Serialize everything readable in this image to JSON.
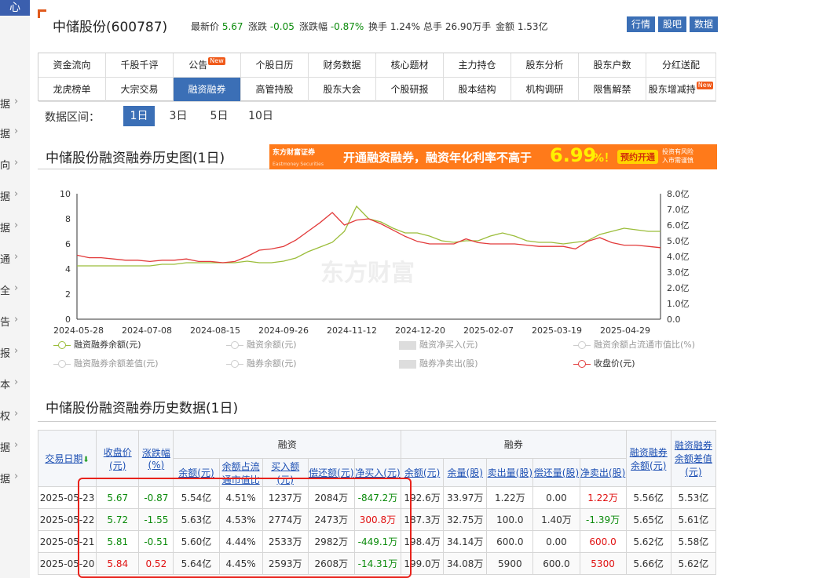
{
  "sidebar": {
    "logo": "心",
    "items": [
      {
        "label": "据",
        "y": 130
      },
      {
        "label": "据",
        "y": 168
      },
      {
        "label": "向",
        "y": 208
      },
      {
        "label": "据",
        "y": 248
      },
      {
        "label": "据",
        "y": 288
      },
      {
        "label": "通",
        "y": 328
      },
      {
        "label": "全",
        "y": 368
      },
      {
        "label": "告",
        "y": 408
      },
      {
        "label": "报",
        "y": 448
      },
      {
        "label": "本",
        "y": 488
      },
      {
        "label": "权",
        "y": 528
      },
      {
        "label": "据",
        "y": 568
      },
      {
        "label": "据",
        "y": 608
      }
    ],
    "chevron": "›"
  },
  "header": {
    "title": "中储股份(600787)",
    "quote": [
      {
        "label": "最新价",
        "value": "5.67",
        "color": "green"
      },
      {
        "label": "涨跌",
        "value": "-0.05",
        "color": "green"
      },
      {
        "label": "涨跌幅",
        "value": "-0.87%",
        "color": "green"
      },
      {
        "label": "换手",
        "value": "1.24%",
        "color": ""
      },
      {
        "label": "总手",
        "value": "26.90万手",
        "color": ""
      },
      {
        "label": "金额",
        "value": "1.53亿",
        "color": ""
      }
    ],
    "buttons": [
      "行情",
      "股吧",
      "数据"
    ]
  },
  "nav": {
    "row1": [
      {
        "label": "资金流向"
      },
      {
        "label": "千股千评"
      },
      {
        "label": "公告",
        "badge": "New"
      },
      {
        "label": "个股日历"
      },
      {
        "label": "财务数据"
      },
      {
        "label": "核心题材"
      },
      {
        "label": "主力持仓"
      },
      {
        "label": "股东分析"
      },
      {
        "label": "股东户数"
      },
      {
        "label": "分红送配"
      }
    ],
    "row2": [
      {
        "label": "龙虎榜单"
      },
      {
        "label": "大宗交易"
      },
      {
        "label": "融资融券",
        "active": true
      },
      {
        "label": "高管持股"
      },
      {
        "label": "股东大会"
      },
      {
        "label": "个股研报"
      },
      {
        "label": "股本结构"
      },
      {
        "label": "机构调研"
      },
      {
        "label": "限售解禁"
      },
      {
        "label": "股东增减持",
        "badge": "New"
      }
    ]
  },
  "range": {
    "label": "数据区间：",
    "options": [
      "1日",
      "3日",
      "5日",
      "10日"
    ],
    "active": "1日"
  },
  "chart_section": {
    "title": "中储股份融资融券历史图(1日)"
  },
  "ad": {
    "logo": "东方财富证券",
    "logo_en": "Eastmoney Securities",
    "text": "开通融资融券，融资年化利率不高于",
    "rate": "6.99",
    "pct": "%！",
    "button": "预约开通",
    "risk1": "投资有风险",
    "risk2": "入市需谨慎"
  },
  "chart_data": {
    "type": "line",
    "watermark": "东方财富",
    "x_ticks": [
      "2024-05-28",
      "2024-07-08",
      "2024-08-15",
      "2024-09-26",
      "2024-11-12",
      "2024-12-20",
      "2025-02-07",
      "2025-03-19",
      "2025-04-29"
    ],
    "y_left": {
      "min": 0,
      "max": 10,
      "ticks": [
        "0",
        "2",
        "4",
        "6",
        "8",
        "10"
      ]
    },
    "y_right": {
      "min": 0,
      "max": 8,
      "ticks": [
        "0.0",
        "1.0亿",
        "2.0亿",
        "3.0亿",
        "4.0亿",
        "5.0亿",
        "6.0亿",
        "7.0亿",
        "8.0亿"
      ]
    },
    "series": [
      {
        "name": "融资融券余额(元)",
        "axis": "right",
        "color": "#9bbd3a",
        "values": [
          3.4,
          3.4,
          3.4,
          3.4,
          3.4,
          3.4,
          3.4,
          3.5,
          3.5,
          3.6,
          3.6,
          3.6,
          3.6,
          3.6,
          3.7,
          3.6,
          3.6,
          3.7,
          3.9,
          4.3,
          4.6,
          4.9,
          5.6,
          7.2,
          6.4,
          6.2,
          5.8,
          5.5,
          5.5,
          5.3,
          5.0,
          4.9,
          5.0,
          5.0,
          5.3,
          5.5,
          5.3,
          5.0,
          4.9,
          4.9,
          4.8,
          4.9,
          5.0,
          5.4,
          5.6,
          5.8,
          5.7,
          5.6,
          5.6
        ]
      },
      {
        "name": "收盘价(元)",
        "axis": "left",
        "color": "#e23a3a",
        "values": [
          5.1,
          4.9,
          4.9,
          4.8,
          4.7,
          4.7,
          4.6,
          4.7,
          4.7,
          4.8,
          4.6,
          4.6,
          4.5,
          4.6,
          5.0,
          5.5,
          5.6,
          5.8,
          6.3,
          7.0,
          7.7,
          8.5,
          7.5,
          7.9,
          8.0,
          7.6,
          7.1,
          6.6,
          6.2,
          6.0,
          6.0,
          6.0,
          6.4,
          6.1,
          6.0,
          6.0,
          6.0,
          5.9,
          5.8,
          5.8,
          5.8,
          5.6,
          6.2,
          6.5,
          6.1,
          5.9,
          5.9,
          5.8,
          5.7
        ]
      }
    ],
    "legend": [
      {
        "label": "融资融券余额(元)",
        "on": true,
        "color": "#9bbd3a",
        "kind": "line"
      },
      {
        "label": "融资余额(元)",
        "on": false,
        "kind": "line"
      },
      {
        "label": "融资净买入(元)",
        "on": false,
        "kind": "bar"
      },
      {
        "label": "融资余额占流通市值比(%)",
        "on": false,
        "kind": "line"
      },
      {
        "label": "融资融券余额差值(元)",
        "on": false,
        "kind": "line"
      },
      {
        "label": "融券余额(元)",
        "on": false,
        "kind": "line"
      },
      {
        "label": "融券净卖出(股)",
        "on": false,
        "kind": "bar"
      },
      {
        "label": "收盘价(元)",
        "on": true,
        "color": "#e23a3a",
        "kind": "line"
      }
    ]
  },
  "table_section": {
    "title": "中储股份融资融券历史数据(1日)"
  },
  "table": {
    "head1": {
      "date": "交易日期",
      "close": "收盘价(元)",
      "chg": "涨跌幅(%)",
      "rz": "融资",
      "rq": "融券",
      "total": "融资融券余额(元)",
      "diff": "融资融券余额差值(元)"
    },
    "head2": [
      "余额(元)",
      "余额占流通市值比",
      "买入额(元)",
      "偿还额(元)",
      "净买入(元)",
      "余额(元)",
      "余量(股)",
      "卖出量(股)",
      "偿还量(股)",
      "净卖出(股)"
    ],
    "rows": [
      [
        "2025-05-23",
        "5.67",
        "-0.87",
        "5.54亿",
        "4.51%",
        "1237万",
        "2084万",
        "-847.2万",
        "192.6万",
        "33.97万",
        "1.22万",
        "0.00",
        "1.22万",
        "5.56亿",
        "5.53亿"
      ],
      [
        "2025-05-22",
        "5.72",
        "-1.55",
        "5.63亿",
        "4.53%",
        "2774万",
        "2473万",
        "300.8万",
        "187.3万",
        "32.75万",
        "100.0",
        "1.40万",
        "-1.39万",
        "5.65亿",
        "5.61亿"
      ],
      [
        "2025-05-21",
        "5.81",
        "-0.51",
        "5.60亿",
        "4.44%",
        "2533万",
        "2982万",
        "-449.1万",
        "198.4万",
        "34.14万",
        "600.0",
        "0.00",
        "600.0",
        "5.62亿",
        "5.58亿"
      ],
      [
        "2025-05-20",
        "5.84",
        "0.52",
        "5.64亿",
        "4.45%",
        "2593万",
        "2608万",
        "-14.31万",
        "199.0万",
        "34.08万",
        "5900",
        "600.0",
        "5300",
        "5.66亿",
        "5.62亿"
      ]
    ]
  }
}
